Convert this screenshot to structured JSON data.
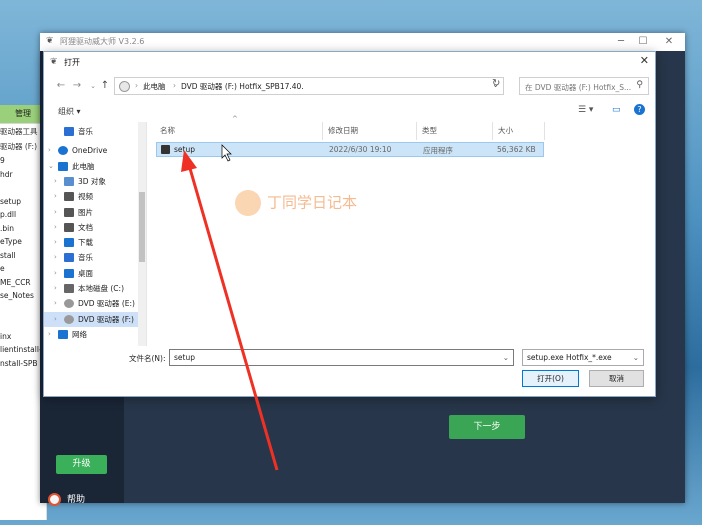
{
  "app": {
    "title": "阿狸驱动威大师 V3.2.6",
    "upgrade_label": "升级",
    "help_label": "帮助",
    "next_label": "下一步",
    "accent": "#3bb05a"
  },
  "bg_explorer": {
    "manage": "管理",
    "tool_label": "驱动器工具",
    "drive_label": "驱动器 (F:)",
    "files": [
      "9",
      "hdr",
      "",
      "setup",
      "p.dll",
      ".bin",
      "eType",
      "stall",
      "e",
      "ME_CCR",
      "se_Notes",
      "",
      "",
      "inx",
      "lientinstall-",
      "nstall-SPB"
    ]
  },
  "dialog": {
    "title": "打开",
    "address": {
      "part1": "此电脑",
      "part2": "DVD 驱动器 (F:) Hotfix_SPB17.40."
    },
    "search_placeholder": "在 DVD 驱动器 (F:) Hotfix_S...",
    "organize": "组织 ▾",
    "nav": [
      {
        "label": "音乐",
        "icon": "music-icon"
      },
      {
        "label": "OneDrive",
        "icon": "cloud-icon"
      },
      {
        "label": "此电脑",
        "icon": "computer-icon"
      },
      {
        "label": "3D 对象",
        "icon": "cube-icon"
      },
      {
        "label": "视频",
        "icon": "video-icon"
      },
      {
        "label": "图片",
        "icon": "picture-icon"
      },
      {
        "label": "文档",
        "icon": "document-icon"
      },
      {
        "label": "下载",
        "icon": "download-icon"
      },
      {
        "label": "音乐",
        "icon": "music-icon"
      },
      {
        "label": "桌面",
        "icon": "desktop-icon"
      },
      {
        "label": "本地磁盘 (C:)",
        "icon": "disk-icon"
      },
      {
        "label": "DVD 驱动器 (E:)",
        "icon": "dvd-icon"
      },
      {
        "label": "DVD 驱动器 (F:)",
        "icon": "dvd-icon"
      },
      {
        "label": "网络",
        "icon": "network-icon"
      }
    ],
    "columns": {
      "name": "名称",
      "date": "修改日期",
      "type": "类型",
      "size": "大小"
    },
    "files": [
      {
        "name": "setup",
        "date": "2022/6/30 19:10",
        "type": "应用程序",
        "size": "56,362 KB"
      }
    ],
    "filename_label": "文件名(N):",
    "filename_value": "setup",
    "filetype_value": "setup.exe Hotfix_*.exe",
    "open_label": "打开(O)",
    "cancel_label": "取消"
  },
  "watermark": "丁同学日记本"
}
